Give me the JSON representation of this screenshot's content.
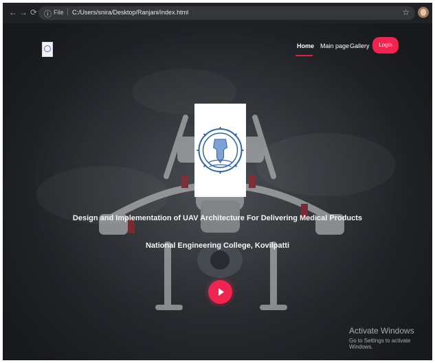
{
  "browser": {
    "nav_icons": [
      "back-icon",
      "forward-icon",
      "reload-icon"
    ],
    "address": {
      "info_icon": "info-icon",
      "scheme_label": "File",
      "url": "C:/Users/snira/Desktop/Ranjani/index.html",
      "bookmark_icon": "star-icon"
    },
    "profile_icon": "profile-avatar-icon"
  },
  "site": {
    "nav": {
      "items": [
        {
          "label": "Home"
        },
        {
          "label": "Main page"
        },
        {
          "label": "Gallery"
        }
      ],
      "login_label": "Login",
      "active_color": "#e11d48"
    },
    "hero": {
      "title": "Design and Implementation of UAV Architecture For Delivering Medical Products",
      "subtitle": "National Engineering College, Kovilpatti"
    },
    "play_icon": "play-icon",
    "accent": "#f1234f"
  },
  "watermark": {
    "title": "Activate Windows",
    "message": "Go to Settings to activate Windows."
  }
}
